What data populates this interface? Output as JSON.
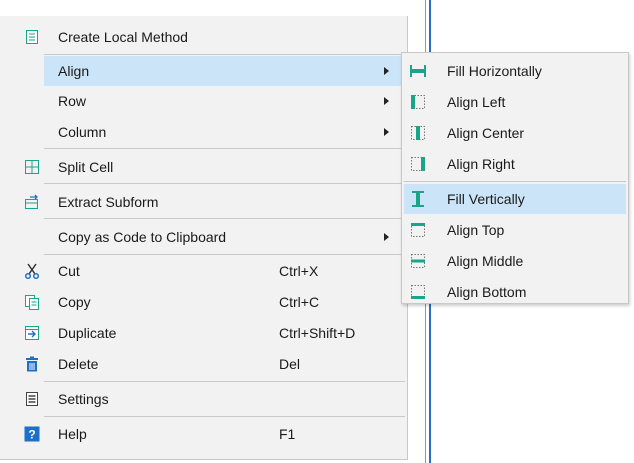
{
  "main_menu": {
    "items": [
      {
        "label": "Create Local Method",
        "shortcut": "",
        "icon": "document-icon"
      },
      {
        "label": "Align",
        "shortcut": "",
        "icon": ""
      },
      {
        "label": "Row",
        "shortcut": "",
        "icon": ""
      },
      {
        "label": "Column",
        "shortcut": "",
        "icon": ""
      },
      {
        "label": "Split Cell",
        "shortcut": "",
        "icon": "split-cell-icon"
      },
      {
        "label": "Extract Subform",
        "shortcut": "",
        "icon": "extract-subform-icon"
      },
      {
        "label": "Copy as Code to Clipboard",
        "shortcut": "",
        "icon": ""
      },
      {
        "label": "Cut",
        "shortcut": "Ctrl+X",
        "icon": "scissors-icon"
      },
      {
        "label": "Copy",
        "shortcut": "Ctrl+C",
        "icon": "copy-icon"
      },
      {
        "label": "Duplicate",
        "shortcut": "Ctrl+Shift+D",
        "icon": "duplicate-icon"
      },
      {
        "label": "Delete",
        "shortcut": "Del",
        "icon": "trash-icon"
      },
      {
        "label": "Settings",
        "shortcut": "",
        "icon": "settings-icon"
      },
      {
        "label": "Help",
        "shortcut": "F1",
        "icon": "help-icon"
      }
    ]
  },
  "sub_menu": {
    "items": [
      {
        "label": "Fill Horizontally",
        "icon": "fill-horizontally-icon"
      },
      {
        "label": "Align Left",
        "icon": "align-left-icon"
      },
      {
        "label": "Align Center",
        "icon": "align-center-icon"
      },
      {
        "label": "Align Right",
        "icon": "align-right-icon"
      },
      {
        "label": "Fill Vertically",
        "icon": "fill-vertically-icon"
      },
      {
        "label": "Align Top",
        "icon": "align-top-icon"
      },
      {
        "label": "Align Middle",
        "icon": "align-middle-icon"
      },
      {
        "label": "Align Bottom",
        "icon": "align-bottom-icon"
      }
    ]
  },
  "colors": {
    "highlight": "#cce4f7",
    "icon_blue": "#1e6fc8",
    "icon_green": "#1aa58a",
    "menu_bg": "#f2f2f2"
  }
}
